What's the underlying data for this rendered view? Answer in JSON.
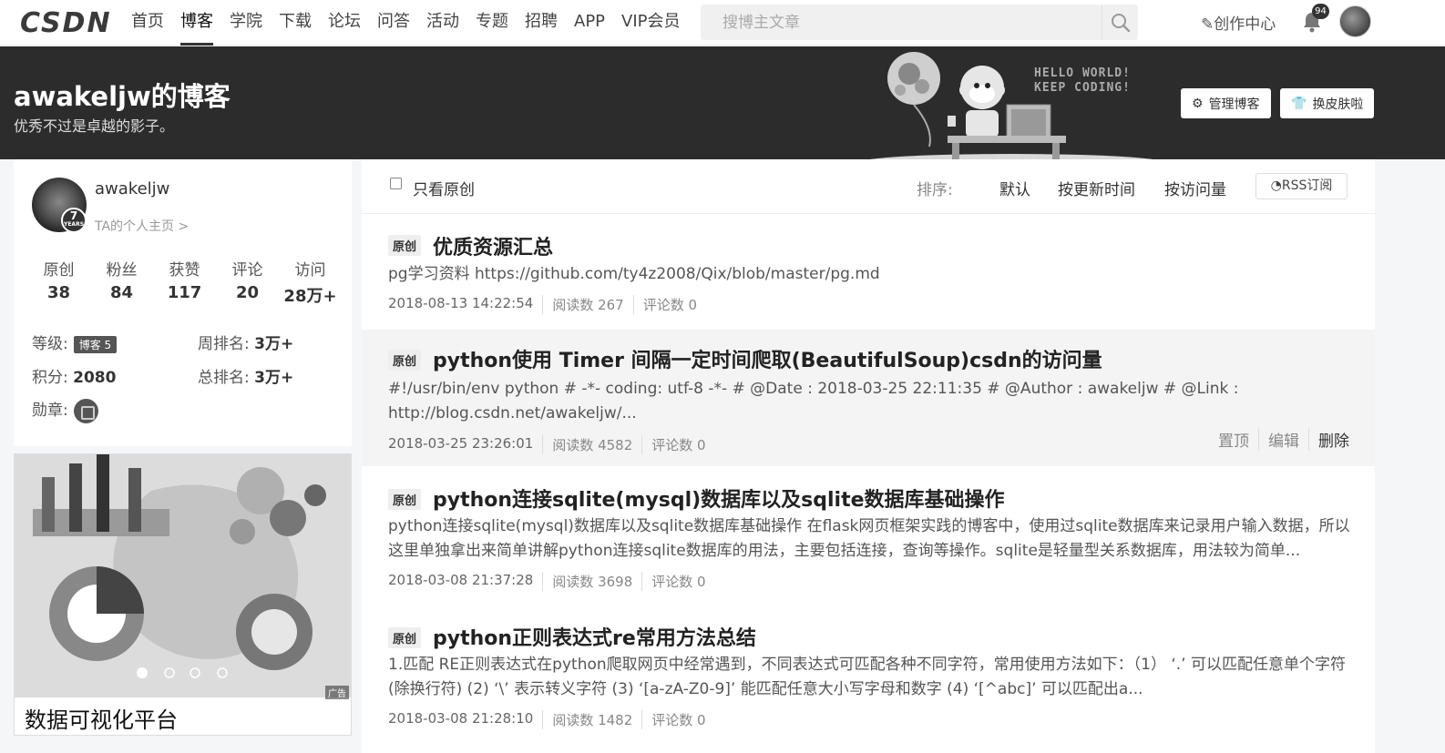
{
  "nav": {
    "logo": "CSDN",
    "links": [
      "首页",
      "博客",
      "学院",
      "下载",
      "论坛",
      "问答",
      "活动",
      "专题",
      "招聘",
      "APP",
      "VIP会员"
    ],
    "active_index": 1,
    "search_placeholder": "搜博主文章",
    "create_label": "创作中心",
    "notification_count": "94"
  },
  "banner": {
    "title": "awakeljw的博客",
    "subtitle": "优秀不过是卓越的影子。",
    "slogan_line1": "HELLO WORLD!",
    "slogan_line2": "KEEP CODING!",
    "manage_label": "管理博客",
    "skin_label": "换皮肤啦"
  },
  "profile": {
    "username": "awakeljw",
    "homepage_link": "TA的个人主页 >",
    "years_badge": "7",
    "years_text": "YEARS",
    "stats": [
      {
        "label": "原创",
        "value": "38"
      },
      {
        "label": "粉丝",
        "value": "84"
      },
      {
        "label": "获赞",
        "value": "117"
      },
      {
        "label": "评论",
        "value": "20"
      },
      {
        "label": "访问",
        "value": "28万+"
      }
    ],
    "level_label": "等级:",
    "level_badge": "博客 5",
    "week_rank_label": "周排名:",
    "week_rank": "3万+",
    "points_label": "积分:",
    "points": "2080",
    "total_rank_label": "总排名:",
    "total_rank": "3万+",
    "medal_label": "勋章:"
  },
  "ad": {
    "caption": "数据可视化平台",
    "tag": "广告"
  },
  "filter": {
    "only_original": "只看原创",
    "sort_label": "排序:",
    "sort_options": [
      "默认",
      "按更新时间",
      "按访问量"
    ],
    "rss_label": "RSS订阅"
  },
  "articles": [
    {
      "tag": "原创",
      "title": "优质资源汇总",
      "desc": "pg学习资料 https://github.com/ty4z2008/Qix/blob/master/pg.md",
      "date": "2018-08-13 14:22:54",
      "reads": "阅读数 267",
      "comments": "评论数 0"
    },
    {
      "tag": "原创",
      "title": "python使用 Timer 间隔一定时间爬取(BeautifulSoup)csdn的访问量",
      "desc": "#!/usr/bin/env python # -*- coding: utf-8 -*- # @Date : 2018-03-25 22:11:35 # @Author : awakeljw # @Link : http://blog.csdn.net/awakeljw/...",
      "date": "2018-03-25 23:26:01",
      "reads": "阅读数 4582",
      "comments": "评论数 0",
      "ops": [
        "置顶",
        "编辑",
        "删除"
      ]
    },
    {
      "tag": "原创",
      "title": "python连接sqlite(mysql)数据库以及sqlite数据库基础操作",
      "desc": "python连接sqlite(mysql)数据库以及sqlite数据库基础操作 在flask网页框架实践的博客中，使用过sqlite数据库来记录用户输入数据，所以这里单独拿出来简单讲解python连接sqlite数据库的用法，主要包括连接，查询等操作。sqlite是轻量型关系数据库，用法较为简单...",
      "date": "2018-03-08 21:37:28",
      "reads": "阅读数 3698",
      "comments": "评论数 0"
    },
    {
      "tag": "原创",
      "title": "python正则表达式re常用方法总结",
      "desc": "1.匹配 RE正则表达式在python爬取网页中经常遇到，不同表达式可匹配各种不同字符，常用使用方法如下：（1） ‘.’ 可以匹配任意单个字符(除换行符) (2) ‘\\’ 表示转义字符 (3) ‘[a-zA-Z0-9]’ 能匹配任意大小写字母和数字 (4) ‘[^abc]’ 可以匹配出a...",
      "date": "2018-03-08 21:28:10",
      "reads": "阅读数 1482",
      "comments": "评论数 0"
    }
  ]
}
